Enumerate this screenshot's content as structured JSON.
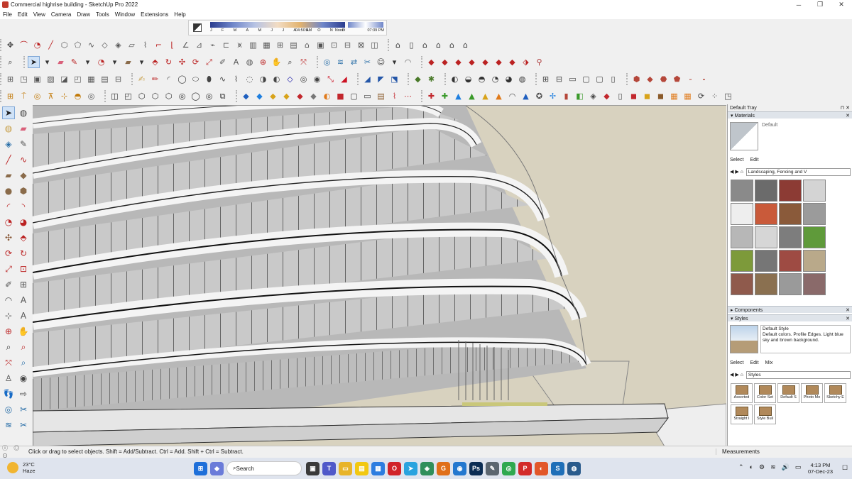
{
  "window": {
    "title": "Commercial highrise building - SketchUp Pro 2022",
    "buttons": {
      "minimize": "─",
      "maximize": "❐",
      "close": "✕"
    }
  },
  "menu": [
    "File",
    "Edit",
    "View",
    "Camera",
    "Draw",
    "Tools",
    "Window",
    "Extensions",
    "Help"
  ],
  "shadows": {
    "months": [
      "J",
      "F",
      "M",
      "A",
      "M",
      "J",
      "J",
      "A",
      "S",
      "O",
      "N",
      "D"
    ],
    "time_start": "04:50 AM",
    "time_mid": "Noon",
    "time_end": "07:39 PM"
  },
  "tray": {
    "title": "Default Tray",
    "pin": "⊓ ✕",
    "materials": {
      "header": "Materials",
      "close": "✕",
      "current": "Default",
      "tabs": [
        "Select",
        "Edit"
      ],
      "library": "Landscaping, Fencing and V",
      "swatches": [
        "#8a8a8a",
        "#6b6b6b",
        "#8c3b34",
        "#d4d4d4",
        "#eeeeee",
        "#c95a3a",
        "#8a5a3a",
        "#9b9b9b",
        "#b7b7b7",
        "#d6d6d6",
        "#7d7d7d",
        "#5f9a3a",
        "#7d9a3a",
        "#767676",
        "#9e4b43",
        "#b9a98a",
        "#8f5a4c",
        "#8a7050",
        "#9a9a9a",
        "#8a6a6a"
      ]
    },
    "components": {
      "header": "Components",
      "close": "✕"
    },
    "styles": {
      "header": "Styles",
      "close": "✕",
      "name": "Default Style",
      "description": "Default colors. Profile Edges. Light blue sky and brown background.",
      "tabs": [
        "Select",
        "Edit",
        "Mix"
      ],
      "library": "Styles",
      "items": [
        "Assorted",
        "Color Set",
        "Default S",
        "Photo Mo",
        "Sketchy E",
        "Straight I",
        "Style Buil"
      ]
    }
  },
  "status": {
    "icons": "ⓘ ◎ ⊙",
    "message": "Click or drag to select objects. Shift = Add/Subtract. Ctrl = Add. Shift + Ctrl = Subtract.",
    "measurements_label": "Measurements"
  },
  "taskbar": {
    "temperature": "23°C",
    "weather": "Haze",
    "search_placeholder": "Search",
    "time": "4:13 PM",
    "date": "07-Dec-23",
    "tray_symbols": [
      "⌃",
      "◐",
      "⚙",
      "≋",
      "🔊",
      "▭"
    ],
    "notification_badge": "☐",
    "apps": [
      {
        "name": "windows-start",
        "symbol": "⊞",
        "color": "#1e6fd9"
      },
      {
        "name": "widgets",
        "symbol": "◆",
        "color": "#6a7bd9"
      },
      {
        "name": "task-view",
        "symbol": "▣",
        "color": "#3a3a3a"
      },
      {
        "name": "teams",
        "symbol": "T",
        "color": "#5059c9"
      },
      {
        "name": "file-explorer",
        "symbol": "▭",
        "color": "#e8b42a"
      },
      {
        "name": "sticky-notes",
        "symbol": "▤",
        "color": "#f2c811"
      },
      {
        "name": "microsoft-store",
        "symbol": "▦",
        "color": "#2d7de0"
      },
      {
        "name": "opera",
        "symbol": "O",
        "color": "#d1232a"
      },
      {
        "name": "telegram",
        "symbol": "➤",
        "color": "#2aa3df"
      },
      {
        "name": "app-green",
        "symbol": "◈",
        "color": "#2f8f5b"
      },
      {
        "name": "app-orange",
        "symbol": "G",
        "color": "#e06f1a"
      },
      {
        "name": "app-blue",
        "symbol": "◉",
        "color": "#2478cf"
      },
      {
        "name": "photoshop",
        "symbol": "Ps",
        "color": "#0c2d54"
      },
      {
        "name": "app-gray",
        "symbol": "✎",
        "color": "#5c6670"
      },
      {
        "name": "chrome",
        "symbol": "◎",
        "color": "#2fa84f"
      },
      {
        "name": "pinterest",
        "symbol": "P",
        "color": "#d32a2a"
      },
      {
        "name": "app-red",
        "symbol": "◐",
        "color": "#e2572a"
      },
      {
        "name": "sketchup",
        "symbol": "S",
        "color": "#1f6fb8"
      },
      {
        "name": "app-teal",
        "symbol": "◍",
        "color": "#2a5b8c"
      }
    ]
  }
}
